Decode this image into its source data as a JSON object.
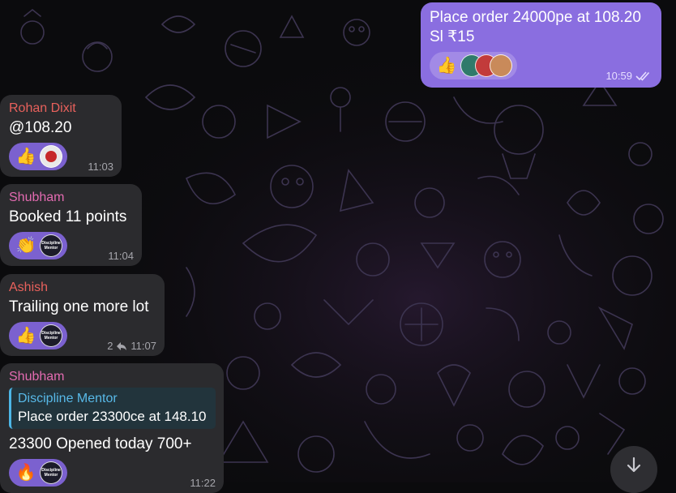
{
  "messages": {
    "m0": {
      "text_line1": "Place order 24000pe at 108.20",
      "text_line2": "Sl ₹15",
      "reaction_emoji": "👍",
      "time": "10:59"
    },
    "m1": {
      "sender": "Rohan Dixit",
      "sender_color": "#e8615c",
      "text": "@108.20",
      "reaction_emoji": "👍",
      "time": "11:03"
    },
    "m2": {
      "sender": "Shubham",
      "sender_color": "#e36bb1",
      "text": "Booked 11 points",
      "reaction_emoji": "👏",
      "avatar_text": "Discipline Mentor",
      "time": "11:04"
    },
    "m3": {
      "sender": "Ashish",
      "sender_color": "#e8615c",
      "text": "Trailing one more lot",
      "reaction_emoji": "👍",
      "avatar_text": "Discipline Mentor",
      "reply_count": "2",
      "time": "11:07"
    },
    "m4": {
      "sender": "Shubham",
      "sender_color": "#e36bb1",
      "quote_author": "Discipline Mentor",
      "quote_text": "Place order 23300ce at 148.10",
      "text": "23300 Opened today 700+",
      "reaction_emoji": "🔥",
      "avatar_text": "Discipline Mentor",
      "time": "11:22"
    }
  },
  "icons": {
    "read": "double-check-icon",
    "reply": "reply-arrow-icon",
    "scroll": "arrow-down-icon"
  },
  "colors": {
    "outgoing_bubble": "#8a6ee0",
    "incoming_bubble": "#2b2b2e",
    "reaction_pill": "#7b61cf",
    "quote_accent": "#4db6e6"
  }
}
